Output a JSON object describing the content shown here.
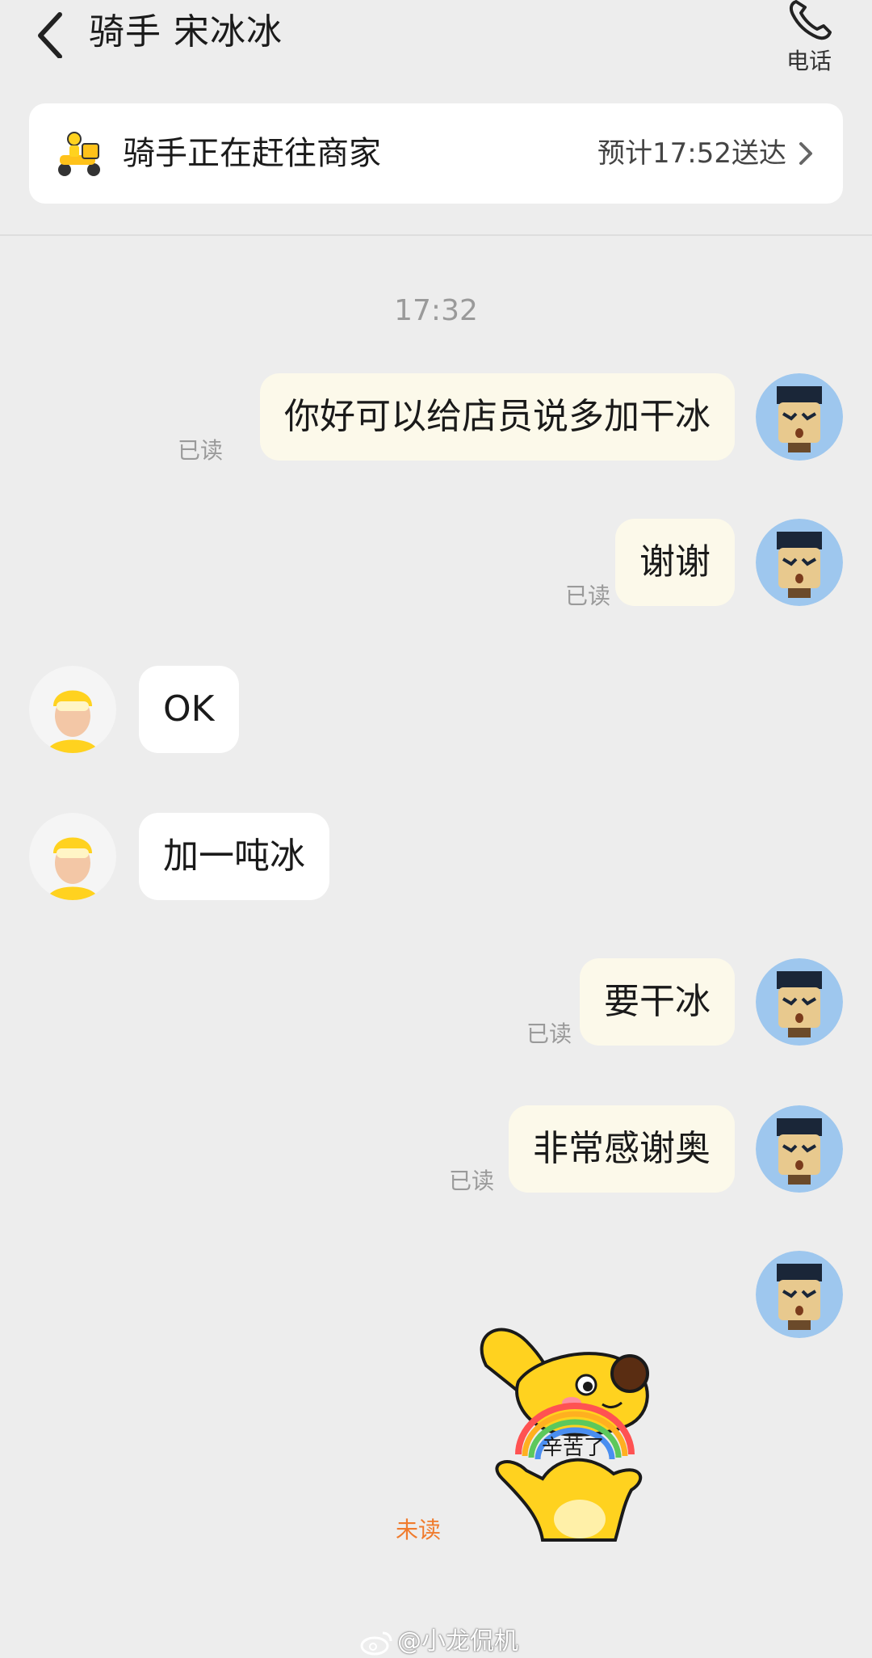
{
  "header": {
    "title": "骑手 宋冰冰",
    "call_label": "电话"
  },
  "status": {
    "text": "骑手正在赶往商家",
    "eta": "预计17:52送达"
  },
  "chat": {
    "timestamp": "17:32",
    "messages": [
      {
        "sender": "me",
        "text": "你好可以给店员说多加干冰",
        "status": "已读"
      },
      {
        "sender": "me",
        "text": "谢谢",
        "status": "已读"
      },
      {
        "sender": "rider",
        "text": "OK"
      },
      {
        "sender": "rider",
        "text": "加一吨冰"
      },
      {
        "sender": "me",
        "text": "要干冰",
        "status": "已读"
      },
      {
        "sender": "me",
        "text": "非常感谢奥",
        "status": "已读"
      },
      {
        "sender": "me",
        "sticker": "辛苦了",
        "status": "未读"
      }
    ]
  },
  "watermark": "@小龙侃机",
  "colors": {
    "background": "#ededed",
    "my_bubble": "#fcf9ea",
    "rider_bubble": "#ffffff",
    "unread": "#f07b2d",
    "brand_yellow": "#ffd21f"
  },
  "icons": {
    "back": "chevron-left-icon",
    "call": "phone-icon",
    "rider_status": "scooter-icon",
    "eta": "chevron-right-icon",
    "watermark": "weibo-icon"
  }
}
